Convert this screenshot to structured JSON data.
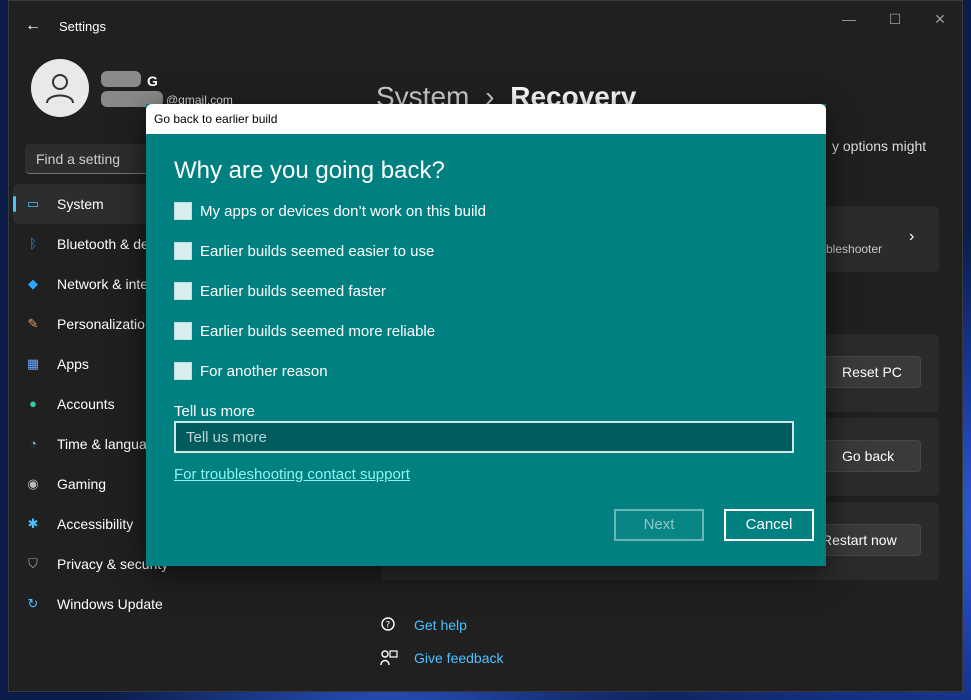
{
  "app": {
    "title": "Settings",
    "back_glyph": "←",
    "min_glyph": "—",
    "max_glyph": "☐",
    "close_glyph": "✕"
  },
  "user": {
    "name": "G",
    "email": "@gmail.com"
  },
  "search": {
    "placeholder": "Find a setting"
  },
  "sidebar": {
    "items": [
      {
        "label": "System",
        "icon": "display-icon",
        "glyph": "▭",
        "color": "#4cc2ff",
        "active": true
      },
      {
        "label": "Bluetooth & de",
        "icon": "bluetooth-icon",
        "glyph": "ᛒ",
        "color": "#1e90ff"
      },
      {
        "label": "Network & inte",
        "icon": "wifi-icon",
        "glyph": "◆",
        "color": "#2aa6ff"
      },
      {
        "label": "Personalization",
        "icon": "brush-icon",
        "glyph": "✎",
        "color": "#f0a060"
      },
      {
        "label": "Apps",
        "icon": "apps-icon",
        "glyph": "▦",
        "color": "#6aa6ff"
      },
      {
        "label": "Accounts",
        "icon": "accounts-icon",
        "glyph": "●",
        "color": "#33c6a0"
      },
      {
        "label": "Time & langua",
        "icon": "clock-icon",
        "glyph": "◔",
        "color": "#4cc2ff"
      },
      {
        "label": "Gaming",
        "icon": "gamepad-icon",
        "glyph": "◉",
        "color": "#bbbbbb"
      },
      {
        "label": "Accessibility",
        "icon": "accessibility-icon",
        "glyph": "✱",
        "color": "#4cc2ff"
      },
      {
        "label": "Privacy & security",
        "icon": "shield-icon",
        "glyph": "⛉",
        "color": "#aaaaaa"
      },
      {
        "label": "Windows Update",
        "icon": "update-icon",
        "glyph": "↻",
        "color": "#4cc2ff"
      }
    ]
  },
  "main": {
    "breadcrumb_parent": "System",
    "breadcrumb_sep": "›",
    "breadcrumb_current": "Recovery",
    "description_fragment": "y options might",
    "card1_text": "bleshooter",
    "card1_chevron": "›",
    "reset_button": "Reset PC",
    "goback_button": "Go back",
    "restart_button": "Restart now",
    "get_help": "Get help",
    "give_feedback": "Give feedback"
  },
  "dialog": {
    "title": "Go back to earlier build",
    "heading": "Why are you going back?",
    "options": [
      "My apps or devices don’t work on this build",
      "Earlier builds seemed easier to use",
      "Earlier builds seemed faster",
      "Earlier builds seemed more reliable",
      "For another reason"
    ],
    "more_label": "Tell us more",
    "more_placeholder": "Tell us more",
    "support_link": "For troubleshooting contact support",
    "next_button": "Next",
    "cancel_button": "Cancel"
  }
}
